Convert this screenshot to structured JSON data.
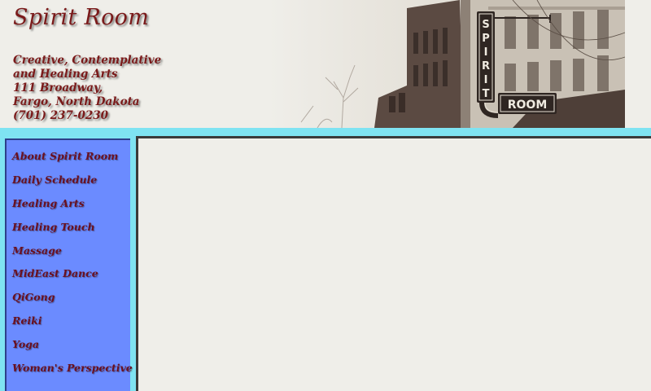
{
  "header": {
    "title": "Spirit Room",
    "address_lines": [
      "Creative, Contemplative",
      "and Healing Arts",
      "111 Broadway,",
      "Fargo, North Dakota",
      "(701) 237-0230"
    ],
    "sign_vertical": [
      "S",
      "P",
      "I",
      "R",
      "I",
      "T"
    ],
    "sign_horizontal": "ROOM"
  },
  "nav": {
    "items": [
      "About Spirit Room",
      "Daily Schedule",
      "Healing Arts",
      "Healing Touch",
      "Massage",
      "MidEast Dance",
      "QiGong",
      "Reiki",
      "Yoga",
      "Woman's Perspective"
    ]
  },
  "colors": {
    "title_text": "#7a1a1a",
    "band": "#7fe3f2",
    "sidebar": "#6b8bff",
    "background": "#efeee9"
  }
}
